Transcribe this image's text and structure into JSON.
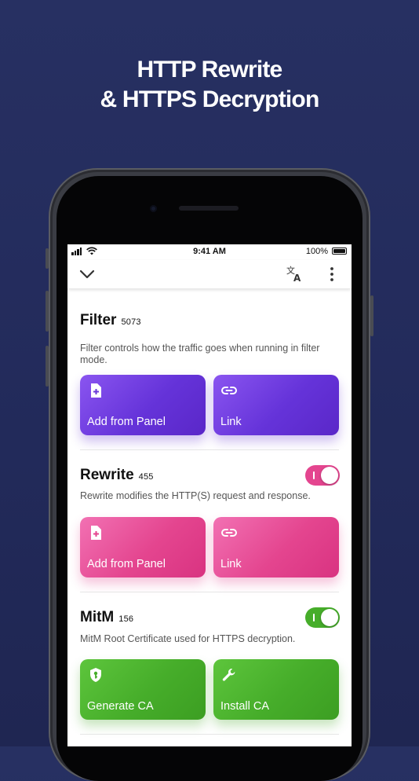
{
  "headline": {
    "line1": "HTTP Rewrite",
    "line2": "& HTTPS Decryption"
  },
  "status_bar": {
    "time": "9:41 AM",
    "battery": "100%"
  },
  "toolbar": {
    "left_icon": "chevron-down-icon",
    "right_icons": [
      "translate-icon",
      "more-vertical-icon"
    ]
  },
  "sections": {
    "filter": {
      "title": "Filter",
      "count": "5073",
      "description": "Filter controls how the traffic goes when running in filter mode.",
      "actions": [
        {
          "label": "Add from Panel",
          "icon": "file-add-icon"
        },
        {
          "label": "Link",
          "icon": "link-icon"
        }
      ],
      "color": "#6533d9"
    },
    "rewrite": {
      "title": "Rewrite",
      "count": "455",
      "enabled": true,
      "description": "Rewrite modifies the HTTP(S) request and response.",
      "actions": [
        {
          "label": "Add from Panel",
          "icon": "file-add-icon"
        },
        {
          "label": "Link",
          "icon": "link-icon"
        }
      ],
      "color": "#e4458f"
    },
    "mitm": {
      "title": "MitM",
      "count": "156",
      "enabled": true,
      "description": "MitM Root Certificate used for HTTPS decryption.",
      "actions": [
        {
          "label": "Generate CA",
          "icon": "shield-key-icon"
        },
        {
          "label": "Install CA",
          "icon": "wrench-icon"
        }
      ],
      "color": "#46ad2a"
    }
  }
}
